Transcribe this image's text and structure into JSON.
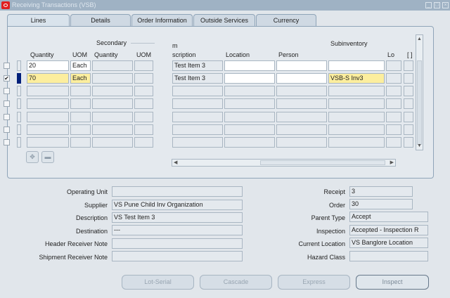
{
  "window": {
    "title": "Receiving Transactions (VSB)"
  },
  "tabs": [
    {
      "label": "Lines"
    },
    {
      "label": "Details"
    },
    {
      "label": "Order Information"
    },
    {
      "label": "Outside Services"
    },
    {
      "label": "Currency"
    }
  ],
  "grid": {
    "group_secondary": "Secondary",
    "group_subinventory": "Subinventory",
    "group_item_partial": "m",
    "col_quantity": "Quantity",
    "col_uom": "UOM",
    "col_sec_quantity": "Quantity",
    "col_sec_uom": "UOM",
    "col_description_partial": "scription",
    "col_location": "Location",
    "col_person": "Person",
    "col_locator_partial": "Lo",
    "col_flex": "[ ]",
    "rows": [
      {
        "checked": "",
        "quantity": "20",
        "uom": "Each",
        "description": "Test Item 3",
        "subinventory": ""
      },
      {
        "checked": "✔",
        "quantity": "70",
        "uom": "Each",
        "description": "Test Item 3",
        "subinventory": "VSB-S Inv3"
      }
    ]
  },
  "details": {
    "operating_unit_label": "Operating Unit",
    "operating_unit": "",
    "supplier_label": "Supplier",
    "supplier": "VS Pune Child Inv Organization",
    "description_label": "Description",
    "description": "VS Test Item 3",
    "destination_label": "Destination",
    "destination": "---",
    "header_note_label": "Header Receiver Note",
    "header_note": "",
    "shipment_note_label": "Shipment Receiver Note",
    "shipment_note": "",
    "receipt_label": "Receipt",
    "receipt": "3",
    "order_label": "Order",
    "order": "30",
    "parent_type_label": "Parent Type",
    "parent_type": "Accept",
    "inspection_label": "Inspection",
    "inspection": "Accepted - Inspection R",
    "current_location_label": "Current Location",
    "current_location": "VS Banglore Location",
    "hazard_class_label": "Hazard Class",
    "hazard_class": ""
  },
  "buttons": {
    "lot_serial": "Lot-Serial",
    "cascade": "Cascade",
    "express": "Express",
    "inspect": "Inspect"
  },
  "colors": {
    "titlebar": "#9fb2c4",
    "current_row": "#fcee9e",
    "row_indicator": "#001f7a"
  }
}
